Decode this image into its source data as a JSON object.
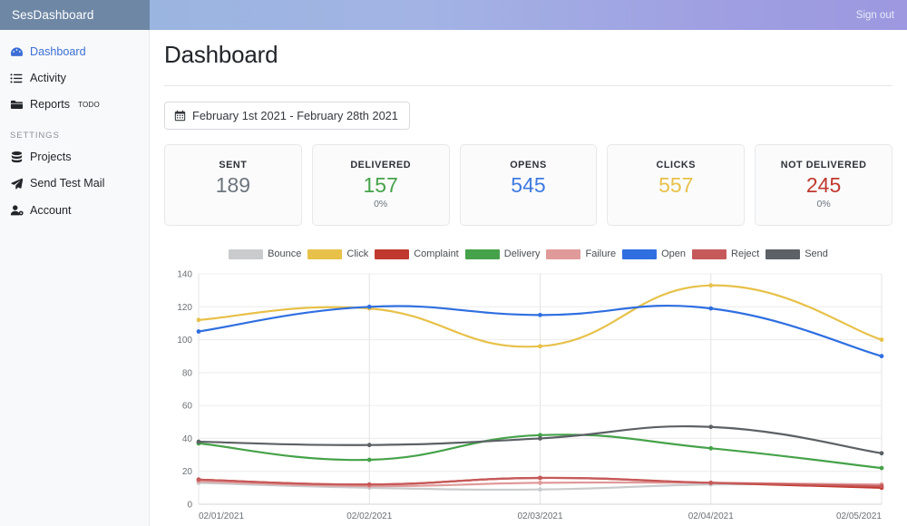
{
  "topbar": {
    "brand": "SesDashboard",
    "signout_label": "Sign out"
  },
  "sidebar": {
    "items": [
      {
        "label": "Dashboard",
        "icon": "tachometer-icon",
        "active": true,
        "todo": ""
      },
      {
        "label": "Activity",
        "icon": "list-icon",
        "active": false,
        "todo": ""
      },
      {
        "label": "Reports",
        "icon": "folder-icon",
        "active": false,
        "todo": "TODO"
      }
    ],
    "section_label": "SETTINGS",
    "settings_items": [
      {
        "label": "Projects",
        "icon": "database-icon"
      },
      {
        "label": "Send Test Mail",
        "icon": "paper-plane-icon"
      },
      {
        "label": "Account",
        "icon": "user-gear-icon"
      }
    ]
  },
  "main": {
    "page_title": "Dashboard",
    "date_range": {
      "icon": "calendar-icon",
      "value": "February 1st 2021 - February 28th 2021"
    },
    "cards": [
      {
        "label": "SENT",
        "value": "189",
        "sub": "",
        "color": "#6c757d"
      },
      {
        "label": "DELIVERED",
        "value": "157",
        "sub": "0%",
        "color": "#46a24a"
      },
      {
        "label": "OPENS",
        "value": "545",
        "sub": "",
        "color": "#3f7ae0"
      },
      {
        "label": "CLICKS",
        "value": "557",
        "sub": "",
        "color": "#e7c14a"
      },
      {
        "label": "NOT DELIVERED",
        "value": "245",
        "sub": "0%",
        "color": "#c0392f"
      }
    ]
  },
  "chart_data": {
    "type": "line",
    "title": "",
    "xlabel": "",
    "ylabel": "",
    "ylim": [
      0,
      140
    ],
    "yticks": [
      0,
      20,
      40,
      60,
      80,
      100,
      120,
      140
    ],
    "grid": true,
    "legend_position": "top",
    "categories": [
      "02/01/2021",
      "02/02/2021",
      "02/03/2021",
      "02/04/2021",
      "02/05/2021"
    ],
    "series": [
      {
        "name": "Bounce",
        "color": "#c9cbcd",
        "values": [
          13,
          10,
          9,
          12,
          12
        ]
      },
      {
        "name": "Click",
        "color": "#e7c14a",
        "values": [
          112,
          119,
          96,
          133,
          100
        ]
      },
      {
        "name": "Complaint",
        "color": "#c0392f",
        "values": [
          15,
          12,
          16,
          13,
          10
        ]
      },
      {
        "name": "Delivery",
        "color": "#46a24a",
        "values": [
          37,
          27,
          42,
          34,
          22
        ]
      },
      {
        "name": "Failure",
        "color": "#e09a9a",
        "values": [
          14,
          11,
          13,
          13,
          12
        ]
      },
      {
        "name": "Open",
        "color": "#2f6fe0",
        "values": [
          105,
          120,
          115,
          119,
          90
        ]
      },
      {
        "name": "Reject",
        "color": "#c65a5a",
        "values": [
          15,
          12,
          16,
          13,
          11
        ]
      },
      {
        "name": "Send",
        "color": "#5c6166",
        "values": [
          38,
          36,
          40,
          47,
          31
        ]
      }
    ]
  }
}
